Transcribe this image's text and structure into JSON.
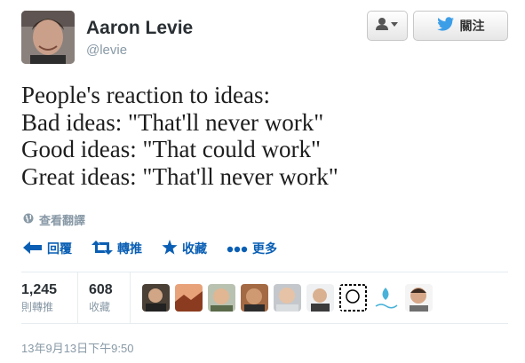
{
  "header": {
    "display_name": "Aaron Levie",
    "handle": "@levie",
    "follow_label": "關注"
  },
  "tweet": {
    "lines": [
      "People's reaction to ideas:",
      "Bad ideas: \"That'll never work\"",
      "Good ideas: \"That could work\"",
      "Great ideas: \"That'll never work\""
    ],
    "translate_label": "查看翻譯"
  },
  "actions": {
    "reply": "回覆",
    "retweet": "轉推",
    "favorite": "收藏",
    "more": "更多"
  },
  "stats": {
    "retweets": {
      "count": "1,245",
      "label": "則轉推"
    },
    "favorites": {
      "count": "608",
      "label": "收藏"
    }
  },
  "timestamp": "13年9月13日下午9:50",
  "colors": {
    "link_blue": "#0a5fb4",
    "twitter_bird": "#3d9ee8",
    "muted_text": "#8899a6"
  },
  "icons": [
    "user-dropdown-icon",
    "twitter-bird-icon",
    "globe-icon",
    "reply-icon",
    "retweet-icon",
    "star-icon",
    "more-dots-icon"
  ]
}
